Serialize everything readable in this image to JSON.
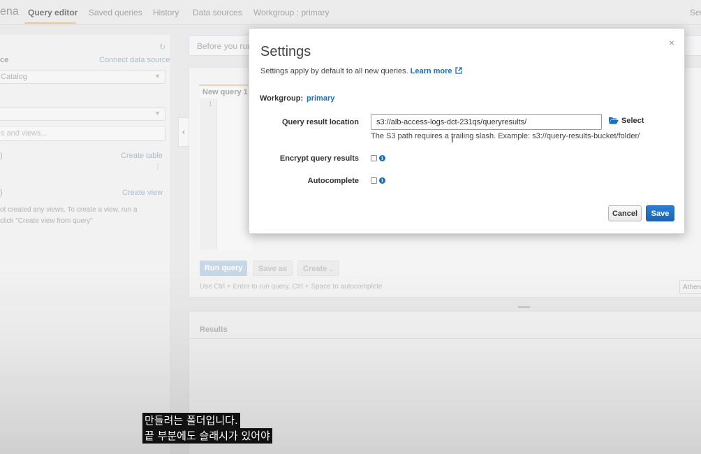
{
  "topnav": {
    "brand": "ena",
    "tabs": [
      "Query editor",
      "Saved queries",
      "History",
      "Data sources",
      "Workgroup : primary"
    ],
    "right_label": "Set"
  },
  "sidebar": {
    "source_heading": "ce",
    "connect_link": "Connect data source",
    "catalog_value": "Catalog",
    "filter_placeholder": "s and views...",
    "tables_heading": ")",
    "create_table_link": "Create table",
    "views_heading": ")",
    "create_view_link": "Create view",
    "views_empty_line1": "ot created any views. To create a view, run a",
    "views_empty_line2": "click \"Create view from query\""
  },
  "background": {
    "hint": "Before you run",
    "editor_tab": "New query 1",
    "line_number": "1",
    "run_query": "Run query",
    "save_as": "Save as",
    "create": "Create",
    "shortcut_hint": "Use Ctrl + Enter to run query, Ctrl + Space to autocomplete",
    "athena_label": "Athen",
    "results_title": "Results"
  },
  "modal": {
    "title": "Settings",
    "description": "Settings apply by default to all new queries.",
    "learn_more": "Learn more",
    "workgroup_label": "Workgroup:",
    "workgroup_value": "primary",
    "qrl_label": "Query result location",
    "qrl_value": "s3://alb-access-logs-dct-231qs/queryresults/",
    "select_label": "Select",
    "path_help": "The S3 path requires a trailing slash. Example: s3://query-results-bucket/folder/",
    "encrypt_label": "Encrypt query results",
    "autocomplete_label": "Autocomplete",
    "cancel_label": "Cancel",
    "save_label": "Save",
    "close_symbol": "×"
  },
  "subtitles": {
    "line1": "만들려는 폴더입니다.",
    "line2": "끝 부분에도 슬래시가 있어야"
  },
  "colors": {
    "accent_blue": "#1a6eb8",
    "save_button": "#1f6fc1"
  }
}
